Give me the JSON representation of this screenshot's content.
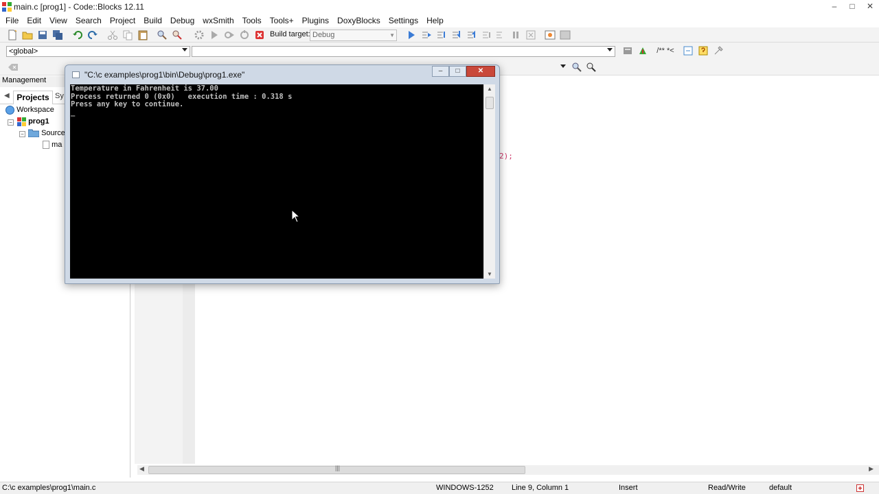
{
  "window": {
    "title": "main.c [prog1] - Code::Blocks 12.11",
    "minimize": "–",
    "maximize": "□",
    "close": "✕"
  },
  "menu": [
    "File",
    "Edit",
    "View",
    "Search",
    "Project",
    "Build",
    "Debug",
    "wxSmith",
    "Tools",
    "Tools+",
    "Plugins",
    "DoxyBlocks",
    "Settings",
    "Help"
  ],
  "toolbar": {
    "build_target_label": "Build target:",
    "build_target_value": "Debug"
  },
  "code_toolbar": {
    "scope_value": "<global>",
    "doxy_comment": "/**",
    "doxy_line": "*<"
  },
  "management": {
    "header": "Management",
    "tab_projects": "Projects",
    "tab_symbols": "Sy",
    "tree": {
      "workspace": "Workspace",
      "project": "prog1",
      "sources": "Sources",
      "file": "ma"
    }
  },
  "editor": {
    "code_fragment": "2);"
  },
  "console": {
    "title": "\"C:\\c examples\\prog1\\bin\\Debug\\prog1.exe\"",
    "lines": [
      "Temperature in Fahrenheit is 37.00",
      "Process returned 0 (0x0)   execution time : 0.318 s",
      "Press any key to continue.",
      "_"
    ]
  },
  "statusbar": {
    "path": "C:\\c examples\\prog1\\main.c",
    "encoding": "WINDOWS-1252",
    "position": "Line 9, Column 1",
    "mode": "Insert",
    "access": "Read/Write",
    "profile": "default"
  },
  "colors": {
    "console_bg": "#000000",
    "console_text": "#c0c0c0",
    "close_button": "#c9483a",
    "code_fragment": "#cc3366"
  }
}
